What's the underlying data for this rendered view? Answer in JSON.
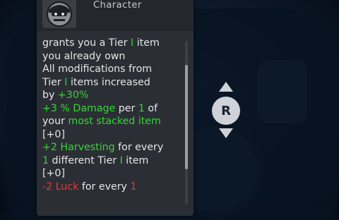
{
  "panel": {
    "type_label": "Character",
    "lines": [
      [
        {
          "t": "grants you a Tier ",
          "c": ""
        },
        {
          "t": "I",
          "c": "g"
        },
        {
          "t": " item",
          "c": ""
        }
      ],
      [
        {
          "t": "you already own",
          "c": ""
        }
      ],
      [
        {
          "t": "All modifications from",
          "c": ""
        }
      ],
      [
        {
          "t": "Tier ",
          "c": ""
        },
        {
          "t": "I",
          "c": "g"
        },
        {
          "t": " items increased",
          "c": ""
        }
      ],
      [
        {
          "t": "by ",
          "c": ""
        },
        {
          "t": "+30%",
          "c": "g"
        }
      ],
      [
        {
          "t": "+3 % Damage",
          "c": "g"
        },
        {
          "t": " per ",
          "c": ""
        },
        {
          "t": "1",
          "c": "g"
        },
        {
          "t": " of",
          "c": ""
        }
      ],
      [
        {
          "t": "your ",
          "c": ""
        },
        {
          "t": "most stacked item",
          "c": "g"
        }
      ],
      [
        {
          "t": "[+0]",
          "c": ""
        }
      ],
      [
        {
          "t": "+2 Harvesting",
          "c": "g"
        },
        {
          "t": " for every",
          "c": ""
        }
      ],
      [
        {
          "t": "1",
          "c": "g"
        },
        {
          "t": " different Tier ",
          "c": ""
        },
        {
          "t": "I",
          "c": "g"
        },
        {
          "t": " item",
          "c": ""
        }
      ],
      [
        {
          "t": "[+0]",
          "c": ""
        }
      ],
      [
        {
          "t": "-2 Luck",
          "c": "r"
        },
        {
          "t": " for every ",
          "c": ""
        },
        {
          "t": "1",
          "c": "r"
        }
      ]
    ]
  },
  "controls": {
    "button_label": "R",
    "up_icon": "arrow-up-icon",
    "down_icon": "arrow-down-icon"
  },
  "colors": {
    "positive": "#35d635",
    "negative": "#e33838",
    "text": "#e6e6e6"
  }
}
